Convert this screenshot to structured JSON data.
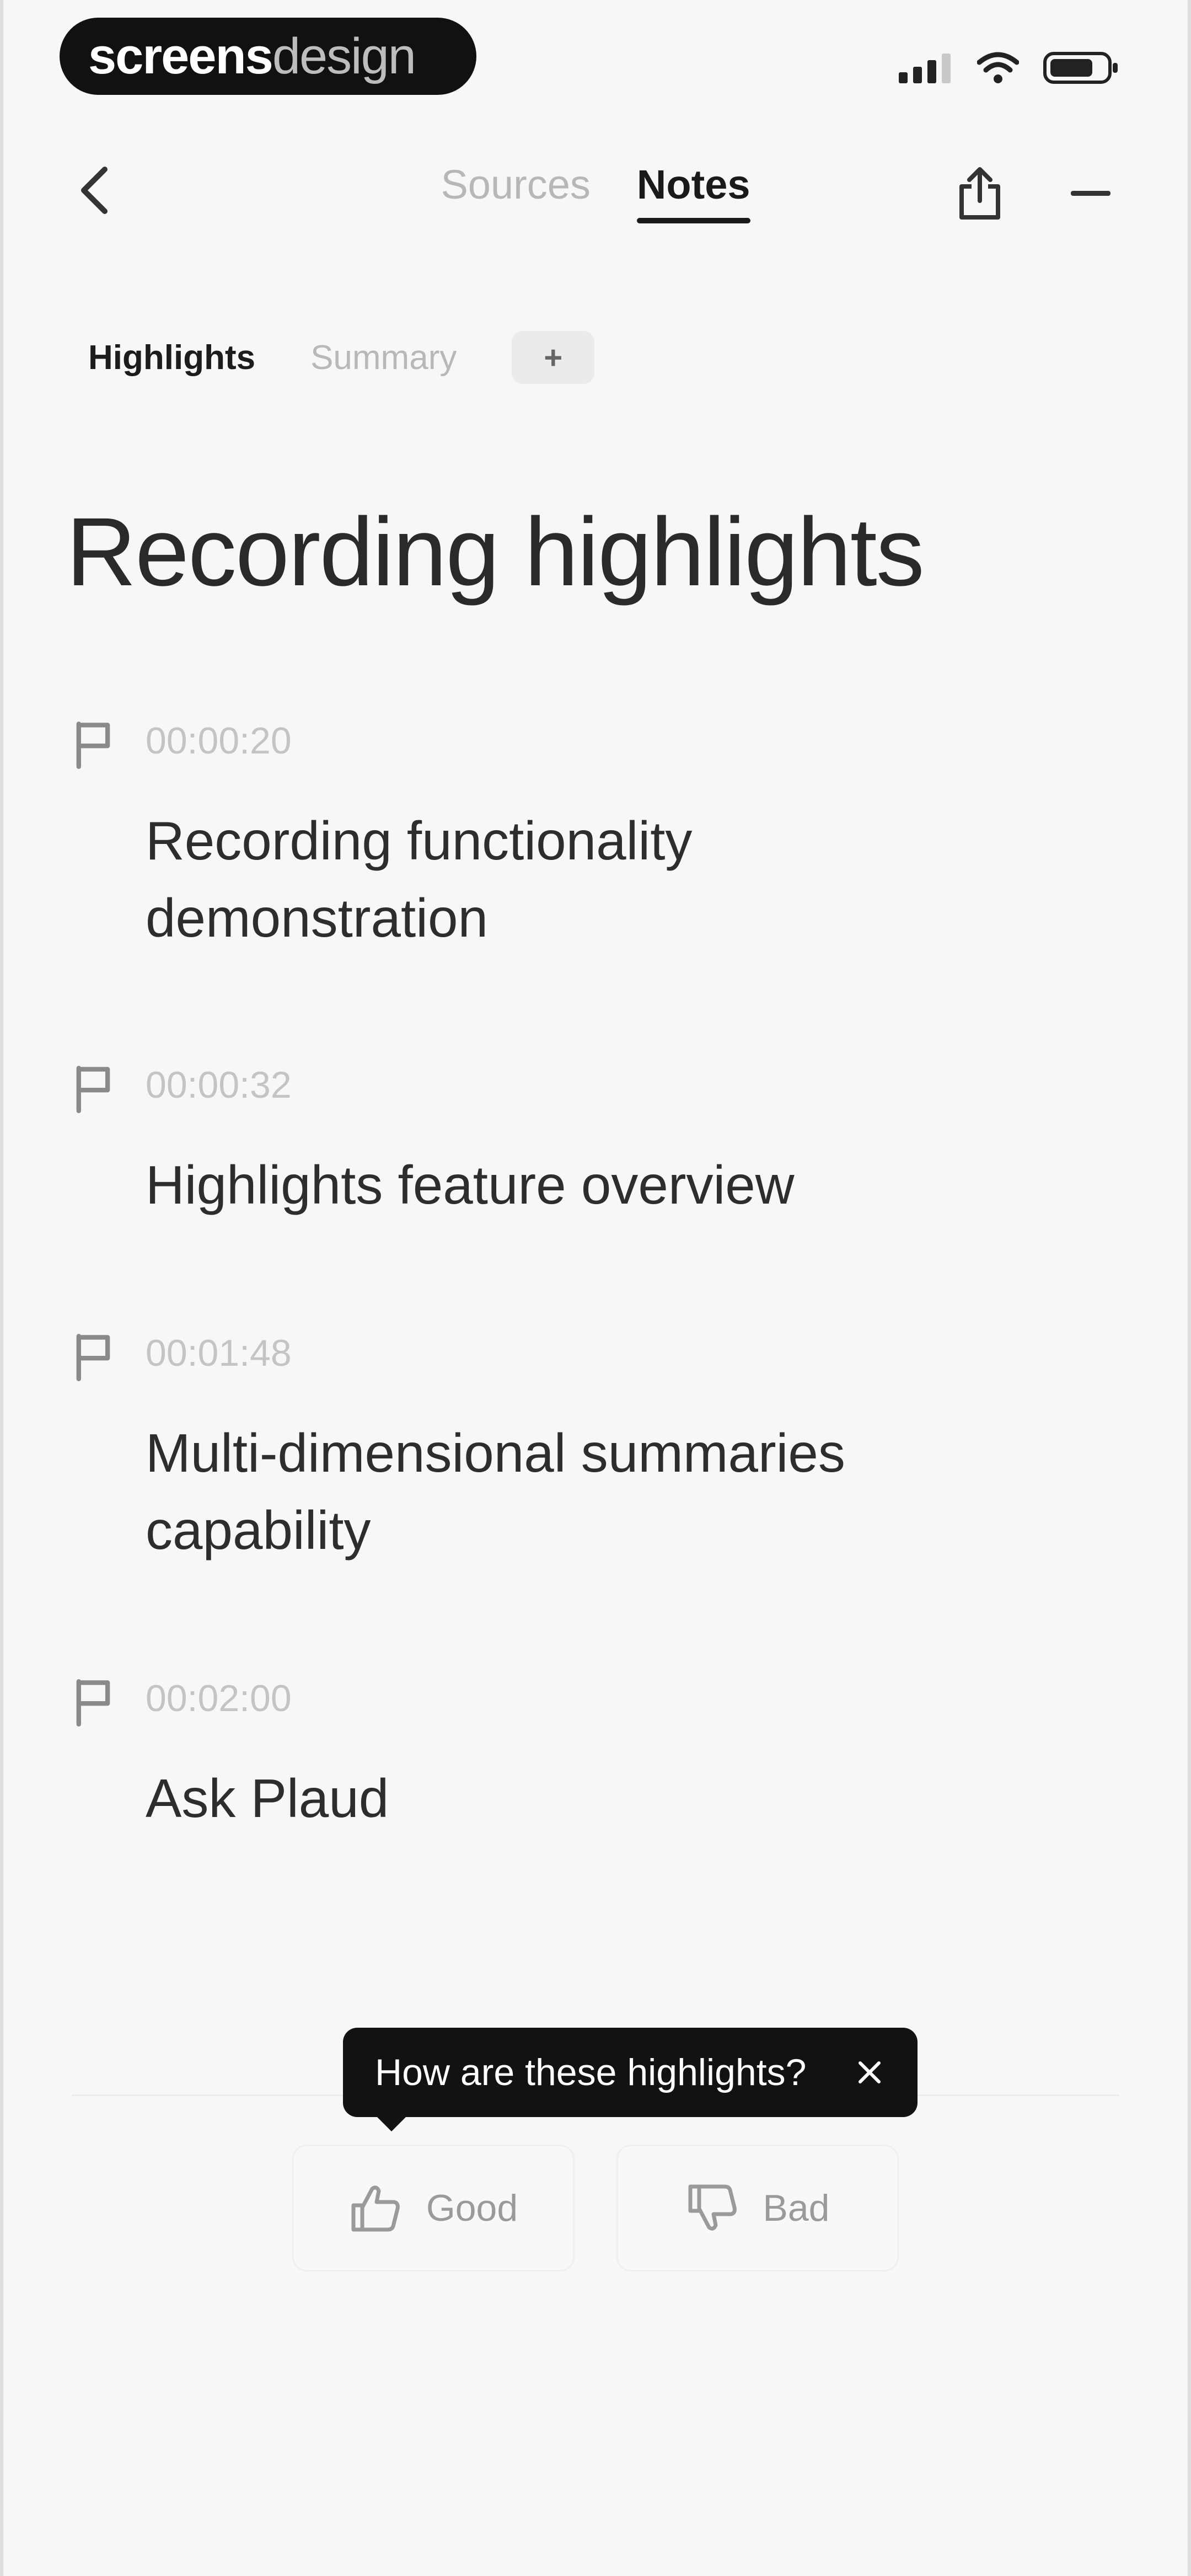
{
  "logo": {
    "bold": "screens",
    "light": "design"
  },
  "status": {
    "icons": [
      "signal-icon",
      "wifi-icon",
      "battery-icon"
    ]
  },
  "nav": {
    "tabs": [
      {
        "label": "Sources",
        "active": false
      },
      {
        "label": "Notes",
        "active": true
      }
    ]
  },
  "subtabs": {
    "items": [
      {
        "label": "Highlights",
        "active": true
      },
      {
        "label": "Summary",
        "active": false
      }
    ],
    "add": "+"
  },
  "title": "Recording highlights",
  "highlights": [
    {
      "time": "00:00:20",
      "lines": [
        "Recording functionality",
        "demonstration"
      ]
    },
    {
      "time": "00:00:32",
      "lines": [
        "Highlights feature overview"
      ]
    },
    {
      "time": "00:01:48",
      "lines": [
        "Multi-dimensional summaries",
        "capability"
      ]
    },
    {
      "time": "00:02:00",
      "lines": [
        "Ask Plaud"
      ]
    }
  ],
  "feedback": {
    "prompt": "How are these highlights?",
    "good": "Good",
    "bad": "Bad"
  },
  "colors": {
    "background": "#f7f7f7",
    "text": "#1f1f1f",
    "muted": "#b7b7b7",
    "tooltip": "#121212"
  }
}
